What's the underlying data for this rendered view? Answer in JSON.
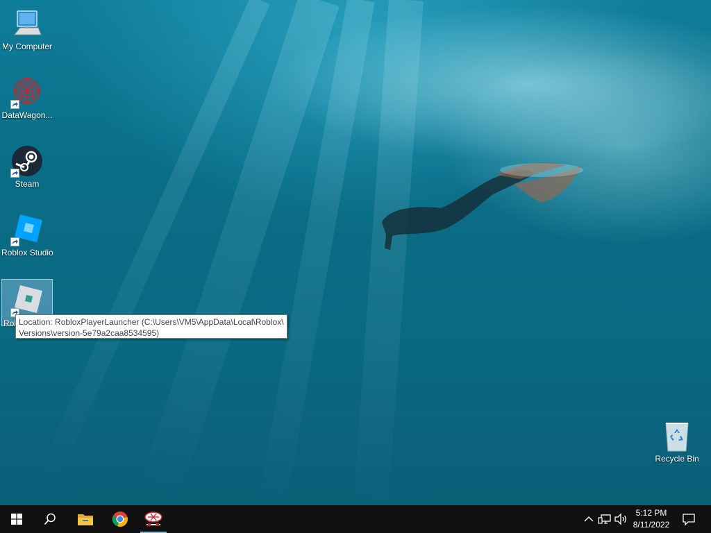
{
  "desktop": {
    "icons": [
      {
        "label": "My Computer"
      },
      {
        "label": "DataWagon..."
      },
      {
        "label": "Steam"
      },
      {
        "label": "Roblox Studio"
      },
      {
        "label": "Rob"
      }
    ],
    "recycle_bin": {
      "label": "Recycle Bin"
    }
  },
  "tooltip": {
    "line1": "Location: RobloxPlayerLauncher (C:\\Users\\VM5\\AppData\\Local\\Roblox\\",
    "line2": "Versions\\version-5e79a2caa8534595)"
  },
  "taskbar": {
    "start_icon": "windows-logo-icon",
    "search_icon": "search-icon",
    "pinned": [
      "file-explorer-icon",
      "chrome-icon",
      "datawagon-icon"
    ],
    "tray": [
      "chevron-up-icon",
      "network-icon",
      "volume-icon"
    ],
    "time": "5:12 PM",
    "date": "8/11/2022",
    "notification_icon": "notification-icon"
  },
  "colors": {
    "taskbar": "#111111",
    "water": "#0a6d86",
    "active_indicator": "#7fb5de"
  }
}
